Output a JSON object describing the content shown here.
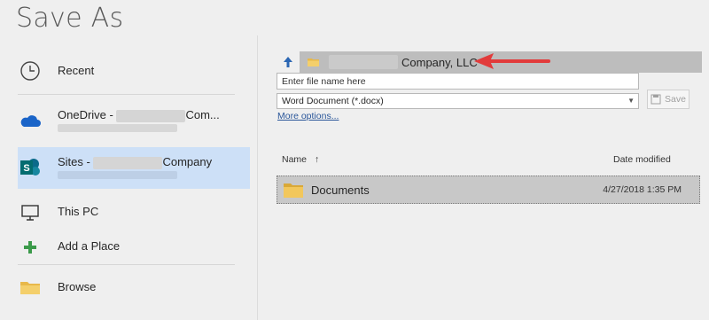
{
  "title": "Save As",
  "locations": [
    {
      "label": "Recent"
    },
    {
      "label_prefix": "OneDrive - ",
      "label_suffix": "Com..."
    },
    {
      "label_prefix": "Sites - ",
      "label_suffix": "Company"
    },
    {
      "label": "This PC"
    },
    {
      "label": "Add a Place"
    },
    {
      "label": "Browse"
    }
  ],
  "path": {
    "label": "Company, LLC"
  },
  "filename": {
    "placeholder": "Enter file name here",
    "value": ""
  },
  "filetype": {
    "selected": "Word Document (*.docx)"
  },
  "more_options": "More options...",
  "save_label": "Save",
  "columns": {
    "name": "Name",
    "sort_indicator": "↑",
    "date": "Date modified"
  },
  "files": [
    {
      "name": "Documents",
      "date": "4/27/2018 1:35 PM"
    }
  ],
  "colors": {
    "selected": "#cde0f7",
    "accent": "#2b579a",
    "annotation": "#e23b3b"
  }
}
